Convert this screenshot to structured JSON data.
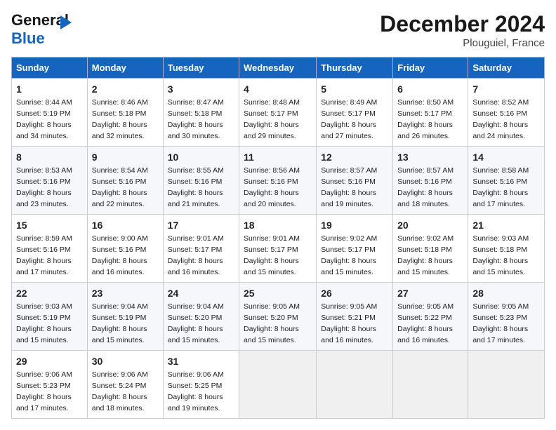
{
  "logo": {
    "line1": "General",
    "line2": "Blue"
  },
  "title": "December 2024",
  "subtitle": "Plouguiel, France",
  "days_of_week": [
    "Sunday",
    "Monday",
    "Tuesday",
    "Wednesday",
    "Thursday",
    "Friday",
    "Saturday"
  ],
  "weeks": [
    [
      {
        "day": "1",
        "sunrise": "Sunrise: 8:44 AM",
        "sunset": "Sunset: 5:19 PM",
        "daylight": "Daylight: 8 hours and 34 minutes."
      },
      {
        "day": "2",
        "sunrise": "Sunrise: 8:46 AM",
        "sunset": "Sunset: 5:18 PM",
        "daylight": "Daylight: 8 hours and 32 minutes."
      },
      {
        "day": "3",
        "sunrise": "Sunrise: 8:47 AM",
        "sunset": "Sunset: 5:18 PM",
        "daylight": "Daylight: 8 hours and 30 minutes."
      },
      {
        "day": "4",
        "sunrise": "Sunrise: 8:48 AM",
        "sunset": "Sunset: 5:17 PM",
        "daylight": "Daylight: 8 hours and 29 minutes."
      },
      {
        "day": "5",
        "sunrise": "Sunrise: 8:49 AM",
        "sunset": "Sunset: 5:17 PM",
        "daylight": "Daylight: 8 hours and 27 minutes."
      },
      {
        "day": "6",
        "sunrise": "Sunrise: 8:50 AM",
        "sunset": "Sunset: 5:17 PM",
        "daylight": "Daylight: 8 hours and 26 minutes."
      },
      {
        "day": "7",
        "sunrise": "Sunrise: 8:52 AM",
        "sunset": "Sunset: 5:16 PM",
        "daylight": "Daylight: 8 hours and 24 minutes."
      }
    ],
    [
      {
        "day": "8",
        "sunrise": "Sunrise: 8:53 AM",
        "sunset": "Sunset: 5:16 PM",
        "daylight": "Daylight: 8 hours and 23 minutes."
      },
      {
        "day": "9",
        "sunrise": "Sunrise: 8:54 AM",
        "sunset": "Sunset: 5:16 PM",
        "daylight": "Daylight: 8 hours and 22 minutes."
      },
      {
        "day": "10",
        "sunrise": "Sunrise: 8:55 AM",
        "sunset": "Sunset: 5:16 PM",
        "daylight": "Daylight: 8 hours and 21 minutes."
      },
      {
        "day": "11",
        "sunrise": "Sunrise: 8:56 AM",
        "sunset": "Sunset: 5:16 PM",
        "daylight": "Daylight: 8 hours and 20 minutes."
      },
      {
        "day": "12",
        "sunrise": "Sunrise: 8:57 AM",
        "sunset": "Sunset: 5:16 PM",
        "daylight": "Daylight: 8 hours and 19 minutes."
      },
      {
        "day": "13",
        "sunrise": "Sunrise: 8:57 AM",
        "sunset": "Sunset: 5:16 PM",
        "daylight": "Daylight: 8 hours and 18 minutes."
      },
      {
        "day": "14",
        "sunrise": "Sunrise: 8:58 AM",
        "sunset": "Sunset: 5:16 PM",
        "daylight": "Daylight: 8 hours and 17 minutes."
      }
    ],
    [
      {
        "day": "15",
        "sunrise": "Sunrise: 8:59 AM",
        "sunset": "Sunset: 5:16 PM",
        "daylight": "Daylight: 8 hours and 17 minutes."
      },
      {
        "day": "16",
        "sunrise": "Sunrise: 9:00 AM",
        "sunset": "Sunset: 5:16 PM",
        "daylight": "Daylight: 8 hours and 16 minutes."
      },
      {
        "day": "17",
        "sunrise": "Sunrise: 9:01 AM",
        "sunset": "Sunset: 5:17 PM",
        "daylight": "Daylight: 8 hours and 16 minutes."
      },
      {
        "day": "18",
        "sunrise": "Sunrise: 9:01 AM",
        "sunset": "Sunset: 5:17 PM",
        "daylight": "Daylight: 8 hours and 15 minutes."
      },
      {
        "day": "19",
        "sunrise": "Sunrise: 9:02 AM",
        "sunset": "Sunset: 5:17 PM",
        "daylight": "Daylight: 8 hours and 15 minutes."
      },
      {
        "day": "20",
        "sunrise": "Sunrise: 9:02 AM",
        "sunset": "Sunset: 5:18 PM",
        "daylight": "Daylight: 8 hours and 15 minutes."
      },
      {
        "day": "21",
        "sunrise": "Sunrise: 9:03 AM",
        "sunset": "Sunset: 5:18 PM",
        "daylight": "Daylight: 8 hours and 15 minutes."
      }
    ],
    [
      {
        "day": "22",
        "sunrise": "Sunrise: 9:03 AM",
        "sunset": "Sunset: 5:19 PM",
        "daylight": "Daylight: 8 hours and 15 minutes."
      },
      {
        "day": "23",
        "sunrise": "Sunrise: 9:04 AM",
        "sunset": "Sunset: 5:19 PM",
        "daylight": "Daylight: 8 hours and 15 minutes."
      },
      {
        "day": "24",
        "sunrise": "Sunrise: 9:04 AM",
        "sunset": "Sunset: 5:20 PM",
        "daylight": "Daylight: 8 hours and 15 minutes."
      },
      {
        "day": "25",
        "sunrise": "Sunrise: 9:05 AM",
        "sunset": "Sunset: 5:20 PM",
        "daylight": "Daylight: 8 hours and 15 minutes."
      },
      {
        "day": "26",
        "sunrise": "Sunrise: 9:05 AM",
        "sunset": "Sunset: 5:21 PM",
        "daylight": "Daylight: 8 hours and 16 minutes."
      },
      {
        "day": "27",
        "sunrise": "Sunrise: 9:05 AM",
        "sunset": "Sunset: 5:22 PM",
        "daylight": "Daylight: 8 hours and 16 minutes."
      },
      {
        "day": "28",
        "sunrise": "Sunrise: 9:05 AM",
        "sunset": "Sunset: 5:23 PM",
        "daylight": "Daylight: 8 hours and 17 minutes."
      }
    ],
    [
      {
        "day": "29",
        "sunrise": "Sunrise: 9:06 AM",
        "sunset": "Sunset: 5:23 PM",
        "daylight": "Daylight: 8 hours and 17 minutes."
      },
      {
        "day": "30",
        "sunrise": "Sunrise: 9:06 AM",
        "sunset": "Sunset: 5:24 PM",
        "daylight": "Daylight: 8 hours and 18 minutes."
      },
      {
        "day": "31",
        "sunrise": "Sunrise: 9:06 AM",
        "sunset": "Sunset: 5:25 PM",
        "daylight": "Daylight: 8 hours and 19 minutes."
      },
      null,
      null,
      null,
      null
    ]
  ]
}
